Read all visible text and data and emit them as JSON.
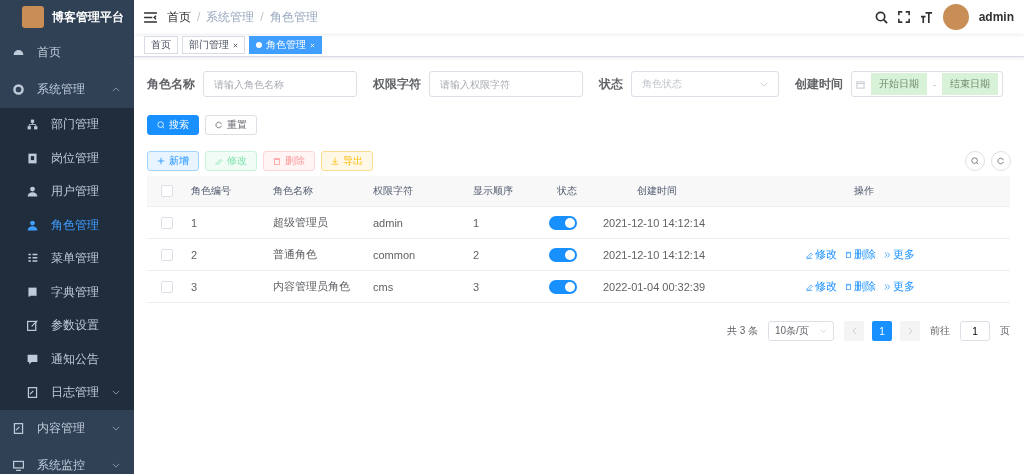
{
  "sidebar": {
    "title": "博客管理平台",
    "menu": [
      {
        "label": "首页",
        "kind": "item",
        "selected": false
      },
      {
        "label": "系统管理",
        "kind": "submenu",
        "expanded": true,
        "children": [
          {
            "label": "部门管理",
            "kind": "item",
            "selected": false
          },
          {
            "label": "岗位管理",
            "kind": "item",
            "selected": false
          },
          {
            "label": "用户管理",
            "kind": "item",
            "selected": false
          },
          {
            "label": "角色管理",
            "kind": "item",
            "selected": true
          },
          {
            "label": "菜单管理",
            "kind": "item",
            "selected": false
          },
          {
            "label": "字典管理",
            "kind": "item",
            "selected": false
          },
          {
            "label": "参数设置",
            "kind": "item",
            "selected": false
          },
          {
            "label": "通知公告",
            "kind": "item",
            "selected": false
          },
          {
            "label": "日志管理",
            "kind": "submenu",
            "expanded": false
          }
        ]
      },
      {
        "label": "内容管理",
        "kind": "submenu",
        "expanded": false
      },
      {
        "label": "系统监控",
        "kind": "submenu",
        "expanded": false
      }
    ]
  },
  "header": {
    "breadcrumb": [
      "首页",
      "系统管理",
      "角色管理"
    ],
    "breadcrumb_separator": "/",
    "user": "admin"
  },
  "tags": [
    {
      "label": "首页",
      "closable": false,
      "selected": false
    },
    {
      "label": "部门管理",
      "closable": true,
      "selected": false
    },
    {
      "label": "角色管理",
      "closable": true,
      "selected": true
    }
  ],
  "filters": [
    {
      "label": "角色名称",
      "kind": "input",
      "placeholder": "请输入角色名称"
    },
    {
      "label": "权限字符",
      "kind": "input",
      "placeholder": "请输入权限字符"
    },
    {
      "label": "状态",
      "kind": "select",
      "placeholder": "角色状态"
    },
    {
      "label": "创建时间",
      "kind": "daterange",
      "placeholder": "开始日期",
      "placeholder_end": "结束日期",
      "separator": "-"
    }
  ],
  "form_buttons": [
    {
      "label": "搜索",
      "kind": "primary"
    },
    {
      "label": "重置",
      "kind": "plain"
    }
  ],
  "toolbar": [
    {
      "label": "新增",
      "kind": "primary",
      "disabled": false
    },
    {
      "label": "修改",
      "kind": "success",
      "disabled": true
    },
    {
      "label": "删除",
      "kind": "danger",
      "disabled": true
    },
    {
      "label": "导出",
      "kind": "warning",
      "disabled": false
    }
  ],
  "table": {
    "all_checked": false,
    "columns": [
      "角色编号",
      "角色名称",
      "权限字符",
      "显示顺序",
      "状态",
      "创建时间",
      "操作"
    ],
    "rows": [
      {
        "id": "1",
        "name": "超级管理员",
        "key": "admin",
        "order": "1",
        "on": true,
        "created": "2021-12-10 14:12:14",
        "checked": false
      },
      {
        "id": "2",
        "name": "普通角色",
        "key": "common",
        "order": "2",
        "on": true,
        "created": "2021-12-10 14:12:14",
        "checked": false,
        "actions": [
          "修改",
          "删除",
          "更多"
        ]
      },
      {
        "id": "3",
        "name": "内容管理员角色",
        "key": "cms",
        "order": "3",
        "on": true,
        "created": "2022-01-04 00:32:39",
        "checked": false,
        "actions": [
          "修改",
          "删除",
          "更多"
        ]
      }
    ]
  },
  "pagination": {
    "total": "共 3 条",
    "page_size": "10条/页",
    "pages": [
      {
        "label": "1",
        "selected": true
      }
    ],
    "goto_label": "前往",
    "goto_value": "1",
    "goto_suffix": "页"
  }
}
